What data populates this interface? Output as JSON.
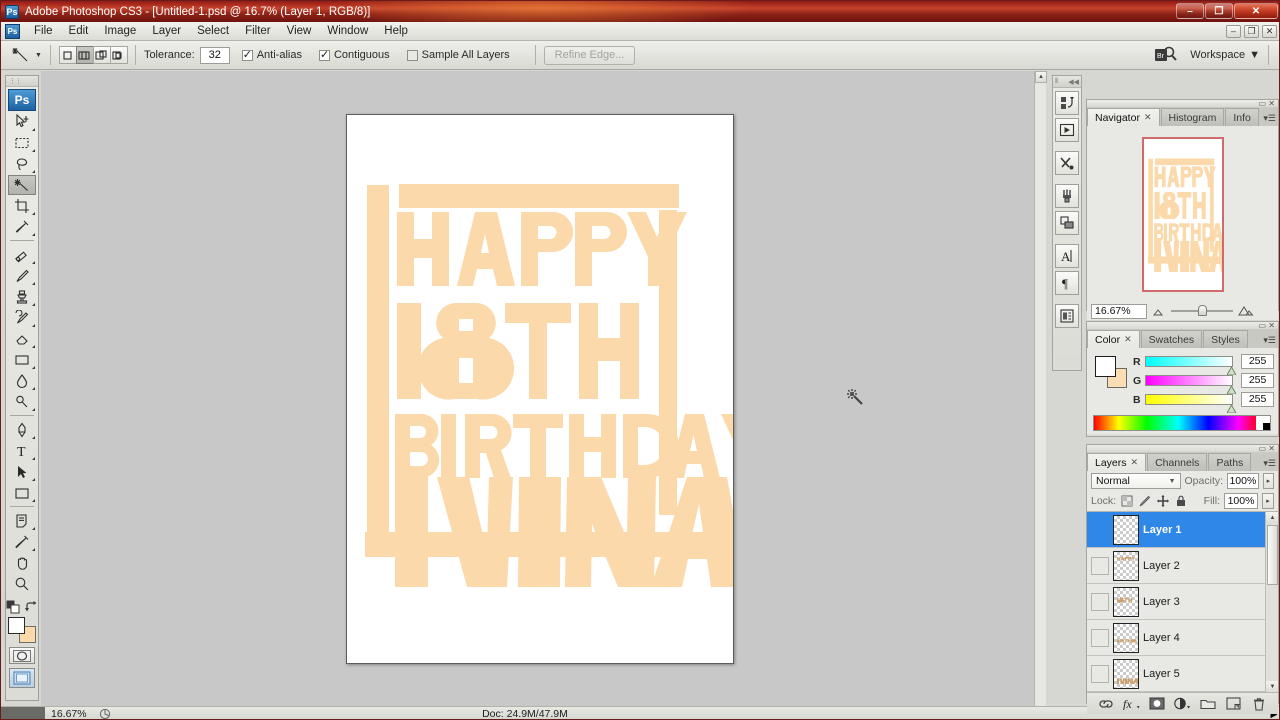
{
  "window": {
    "title": "Adobe Photoshop CS3 - [Untitled-1.psd @ 16.7% (Layer 1, RGB/8)]",
    "app_badge": "Ps",
    "minimize": "–",
    "maximize": "❐",
    "close": "✕"
  },
  "menubar": {
    "badge": "Ps",
    "items": [
      "File",
      "Edit",
      "Image",
      "Layer",
      "Select",
      "Filter",
      "View",
      "Window",
      "Help"
    ],
    "doc_minimize": "–",
    "doc_restore": "❐",
    "doc_close": "✕"
  },
  "options_bar": {
    "active_tool": "magic-wand",
    "selection_modes": [
      "new-selection",
      "add-to-selection",
      "subtract-from-selection",
      "intersect-with-selection"
    ],
    "active_selection_mode": 1,
    "tolerance_label": "Tolerance:",
    "tolerance_value": "32",
    "checkboxes": [
      {
        "label": "Anti-alias",
        "checked": true
      },
      {
        "label": "Contiguous",
        "checked": true
      },
      {
        "label": "Sample All Layers",
        "checked": false
      }
    ],
    "refine_edge": "Refine Edge...",
    "workspace": "Workspace",
    "workspace_caret": "▼"
  },
  "toolbox": {
    "badge": "Ps",
    "selected_tool": "magic-wand",
    "tools": [
      "move-tool",
      "rectangular-marquee-tool",
      "lasso-tool",
      "magic-wand-tool",
      "crop-tool",
      "eyedropper-tool",
      "healing-brush-tool",
      "brush-tool",
      "clone-stamp-tool",
      "history-brush-tool",
      "eraser-tool",
      "gradient-tool",
      "blur-tool",
      "dodge-tool",
      "pen-tool",
      "horizontal-type-tool",
      "path-selection-tool",
      "rectangle-shape-tool",
      "notes-tool",
      "eyedropper-sample-tool",
      "hand-tool",
      "zoom-tool"
    ],
    "foreground_color": "#ffffff",
    "background_color": "#fbd9ab",
    "quick_mask": "edit-in-quick-mask-mode",
    "screen_mode": "change-screen-mode"
  },
  "mini_dock": {
    "items": [
      "history-panel-icon",
      "actions-panel-icon",
      "tool-presets-panel-icon",
      "brushes-panel-icon",
      "clone-source-panel-icon",
      "character-panel-icon",
      "paragraph-panel-icon",
      "layer-comps-panel-icon"
    ]
  },
  "navigator": {
    "tabs": [
      {
        "label": "Navigator",
        "active": true,
        "closable": true
      },
      {
        "label": "Histogram",
        "active": false,
        "closable": false
      },
      {
        "label": "Info",
        "active": false,
        "closable": false
      }
    ],
    "zoom_value": "16.67%",
    "zoom_out_icon": "small-mountain-icon",
    "zoom_in_icon": "large-mountain-icon",
    "view_box_color": "#d16a6a"
  },
  "color_panel": {
    "tabs": [
      {
        "label": "Color",
        "active": true,
        "closable": true
      },
      {
        "label": "Swatches",
        "active": false,
        "closable": false
      },
      {
        "label": "Styles",
        "active": false,
        "closable": false
      }
    ],
    "foreground": "#ffffff",
    "background": "#fbddb4",
    "channels": [
      {
        "name": "R",
        "value": "255"
      },
      {
        "name": "G",
        "value": "255"
      },
      {
        "name": "B",
        "value": "255"
      }
    ]
  },
  "layers_panel": {
    "tabs": [
      {
        "label": "Layers",
        "active": true,
        "closable": true
      },
      {
        "label": "Channels",
        "active": false,
        "closable": false
      },
      {
        "label": "Paths",
        "active": false,
        "closable": false
      }
    ],
    "blend_mode": "Normal",
    "opacity_label": "Opacity:",
    "opacity_value": "100%",
    "lock_label": "Lock:",
    "lock_icons": [
      "lock-transparent-pixels-icon",
      "lock-image-pixels-icon",
      "lock-position-icon",
      "lock-all-icon"
    ],
    "fill_label": "Fill:",
    "fill_value": "100%",
    "layers": [
      {
        "name": "Layer 1",
        "selected": true,
        "visible": false,
        "thumb": "empty"
      },
      {
        "name": "Layer 2",
        "selected": false,
        "visible": false,
        "thumb": "happy"
      },
      {
        "name": "Layer 3",
        "selected": false,
        "visible": false,
        "thumb": "18th"
      },
      {
        "name": "Layer 4",
        "selected": false,
        "visible": false,
        "thumb": "birthday"
      },
      {
        "name": "Layer 5",
        "selected": false,
        "visible": false,
        "thumb": "ivina"
      }
    ],
    "footer_buttons": [
      "link-layers-icon",
      "add-layer-style-icon",
      "add-layer-mask-icon",
      "create-adjustment-layer-icon",
      "create-group-icon",
      "create-new-layer-icon",
      "delete-layer-icon"
    ]
  },
  "status_bar": {
    "zoom": "16.67%",
    "doc_info": "Doc: 24.9M/47.9M",
    "expand_arrow": "▶"
  },
  "document": {
    "artwork_color": "#fbd9ab",
    "background_color": "#ffffff",
    "lines": [
      "HAPPY",
      "18TH",
      "BIRTHDAY",
      "IVINA"
    ],
    "cursor": "magic-wand-cursor"
  }
}
